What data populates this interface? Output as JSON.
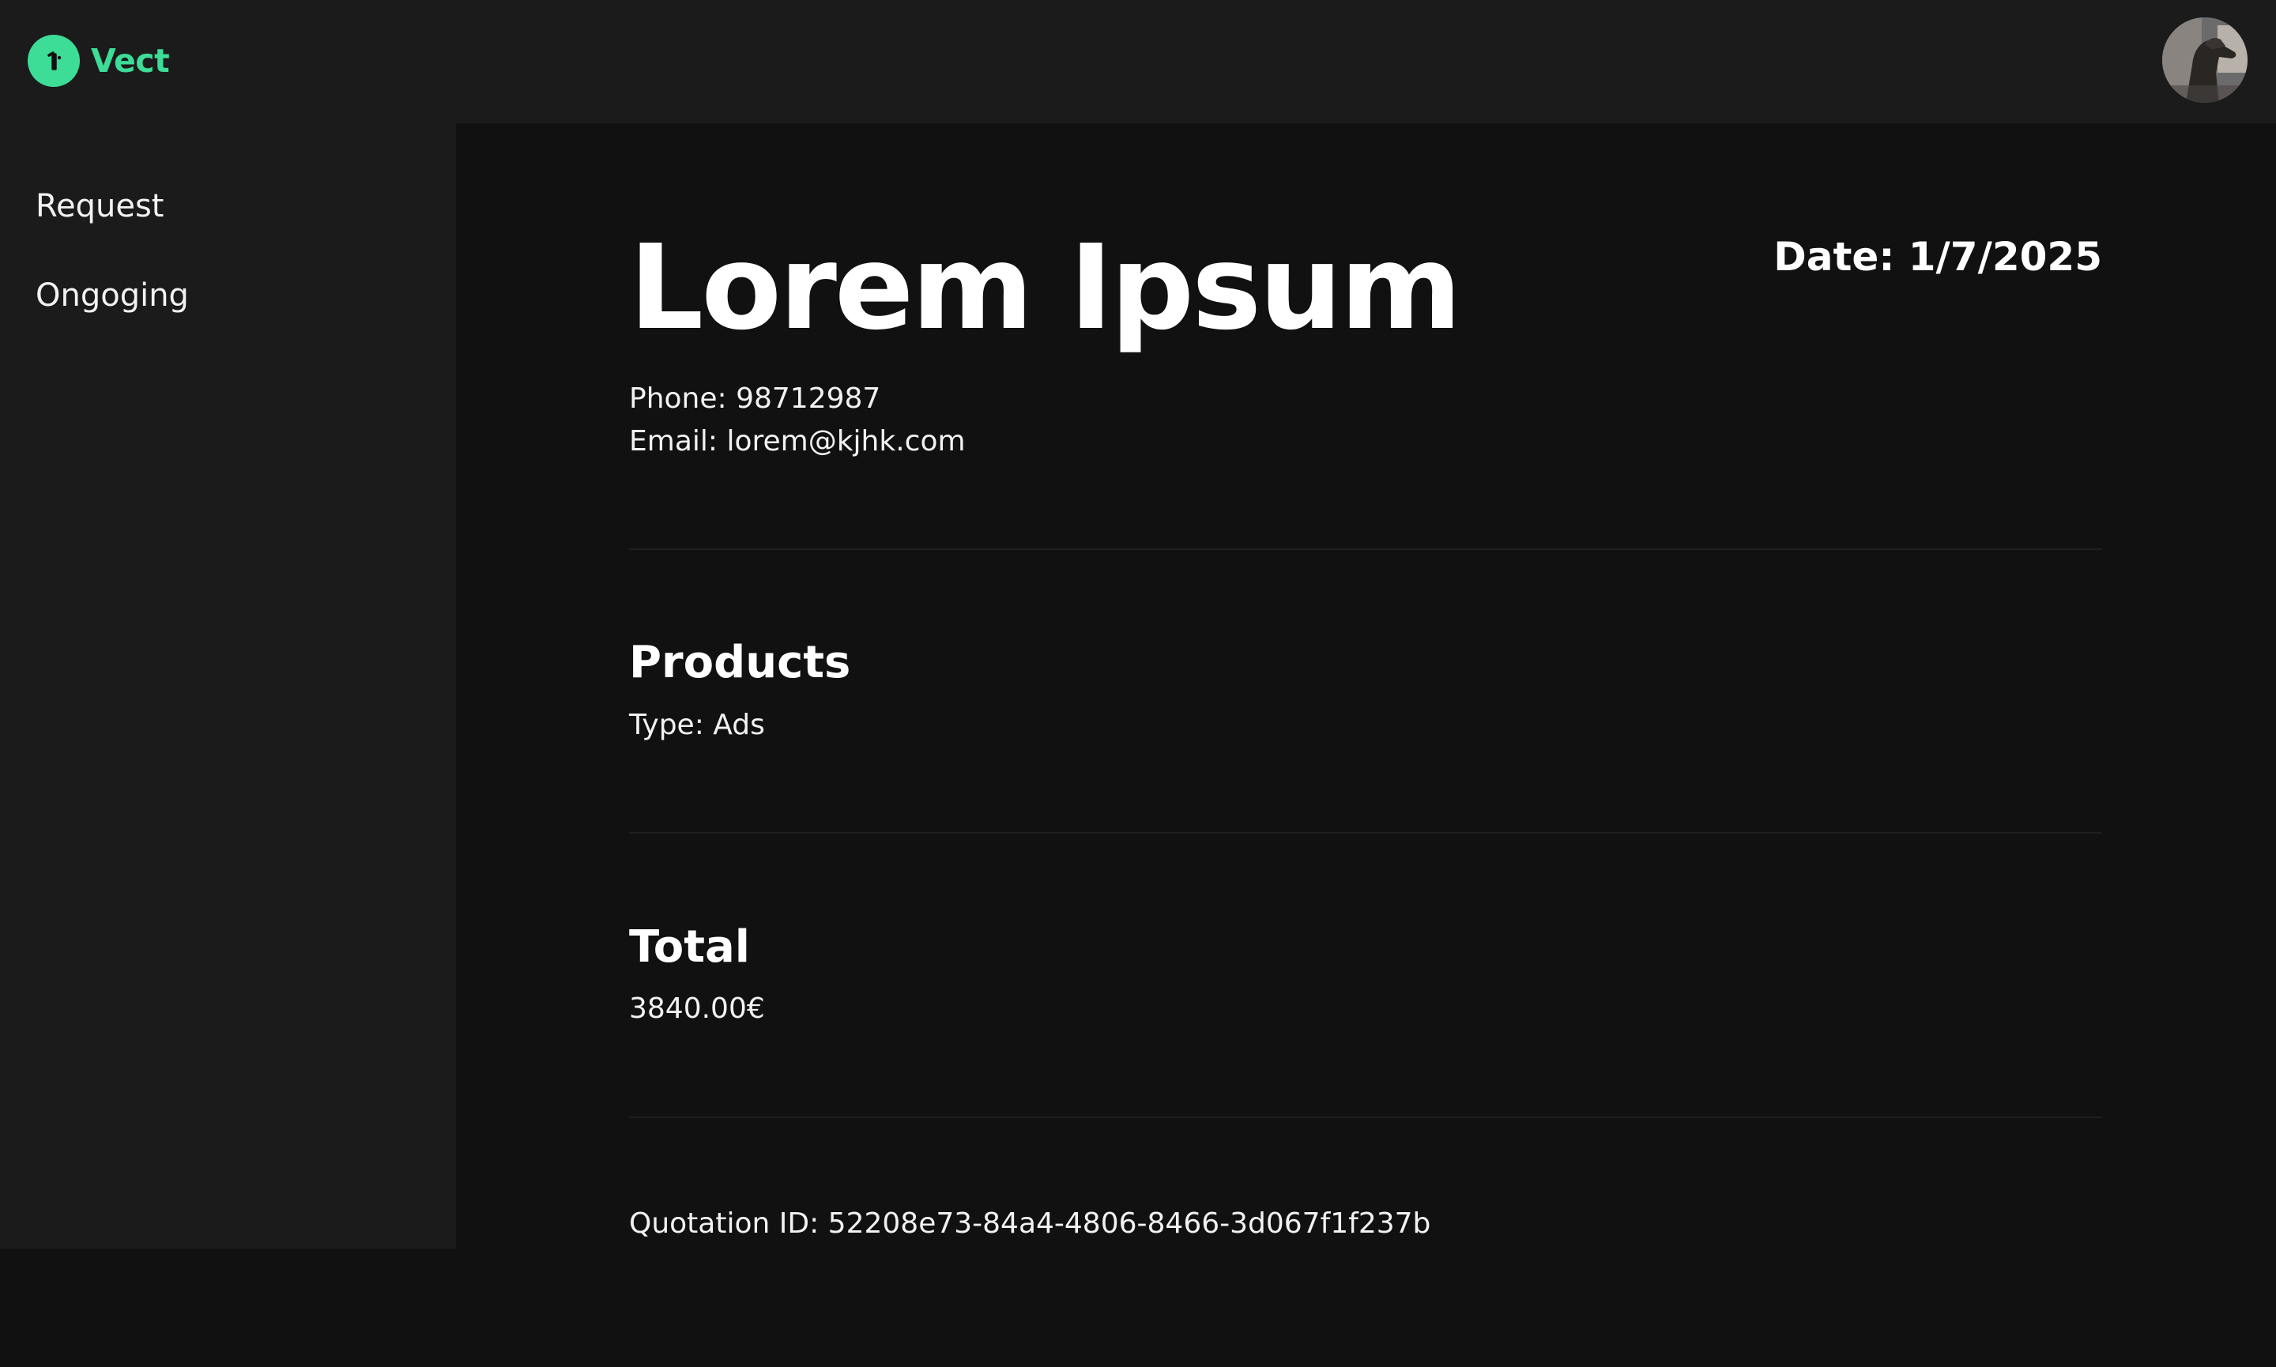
{
  "app": {
    "name": "Vect",
    "brand_color": "#3ddc97",
    "logo_icon": "vect-logo-icon"
  },
  "header": {
    "avatar_icon": "user-avatar"
  },
  "sidebar": {
    "items": [
      {
        "label": "Request"
      },
      {
        "label": "Ongoging"
      }
    ]
  },
  "quotation": {
    "title": "Lorem Ipsum",
    "date": "Date: 1/7/2025",
    "phone": "Phone: 98712987",
    "email": "Email: lorem@kjhk.com",
    "products_heading": "Products",
    "product_type": "Type: Ads",
    "total_heading": "Total",
    "total_value": "3840.00€",
    "quotation_id": "Quotation ID: 52208e73-84a4-4806-8466-3d067f1f237b"
  },
  "colors": {
    "background": "#111111",
    "panel": "#1b1b1b",
    "text": "#ffffff"
  }
}
